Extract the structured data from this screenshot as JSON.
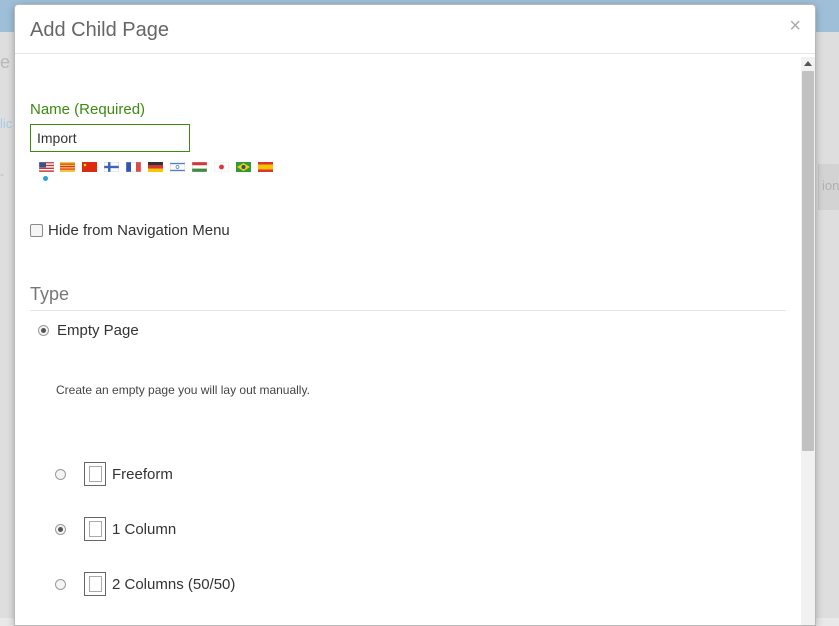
{
  "background": {
    "fragments": [
      "e",
      "lic",
      "- ",
      "ions"
    ]
  },
  "modal": {
    "title": "Add Child Page",
    "close_symbol": "×"
  },
  "name_field": {
    "label": "Name (Required)",
    "value": "Import"
  },
  "language_flags": [
    {
      "icon": "us-flag-icon",
      "selected": true
    },
    {
      "icon": "catalonia-flag-icon"
    },
    {
      "icon": "china-flag-icon"
    },
    {
      "icon": "finland-flag-icon"
    },
    {
      "icon": "france-flag-icon"
    },
    {
      "icon": "germany-flag-icon"
    },
    {
      "icon": "israel-flag-icon"
    },
    {
      "icon": "hungary-flag-icon"
    },
    {
      "icon": "japan-flag-icon"
    },
    {
      "icon": "brazil-flag-icon"
    },
    {
      "icon": "spain-flag-icon"
    }
  ],
  "hide_nav": {
    "label": "Hide from Navigation Menu",
    "checked": false
  },
  "type_section": {
    "heading": "Type",
    "empty_page_label": "Empty Page",
    "empty_page_selected": true,
    "description": "Create an empty page you will lay out manually.",
    "layouts": [
      {
        "label": "Freeform",
        "selected": false
      },
      {
        "label": "1 Column",
        "selected": true
      },
      {
        "label": "2 Columns (50/50)",
        "selected": false
      }
    ]
  },
  "colors": {
    "accent_green": "#3c8a10",
    "flag_dot": "#29a3d6"
  }
}
